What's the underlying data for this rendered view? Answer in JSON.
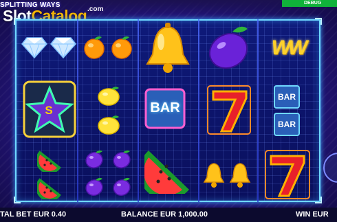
{
  "game": {
    "title": "SPLITTING WAYS",
    "debug_label": "DEBUG",
    "colors": {
      "frame": "#6fd8ff",
      "background": "#23157a",
      "debug": "#10b23a"
    }
  },
  "watermark": {
    "brand_part1": "Slot",
    "brand_part2": "Catalog",
    "tld": ".com"
  },
  "reels": [
    {
      "name": "reel-1",
      "symbols": [
        "diamond",
        "diamond",
        "star-scatter",
        "watermelon",
        "watermelon"
      ]
    },
    {
      "name": "reel-2",
      "symbols": [
        "orange",
        "orange",
        "lemon",
        "lemon",
        "plum",
        "plum",
        "plum",
        "plum"
      ]
    },
    {
      "name": "reel-3",
      "symbols": [
        "bell",
        "bar",
        "watermelon"
      ]
    },
    {
      "name": "reel-4",
      "symbols": [
        "plum",
        "seven",
        "bell",
        "bell"
      ]
    },
    {
      "name": "reel-5",
      "symbols": [
        "wild",
        "bar",
        "bar",
        "seven"
      ]
    }
  ],
  "symbol_text": {
    "scatter": "S",
    "bar": "BAR",
    "wild": "WW"
  },
  "status": {
    "total_bet": "TAL BET EUR 0.40",
    "balance": "BALANCE EUR 1,000.00",
    "win": "WIN EUR"
  }
}
